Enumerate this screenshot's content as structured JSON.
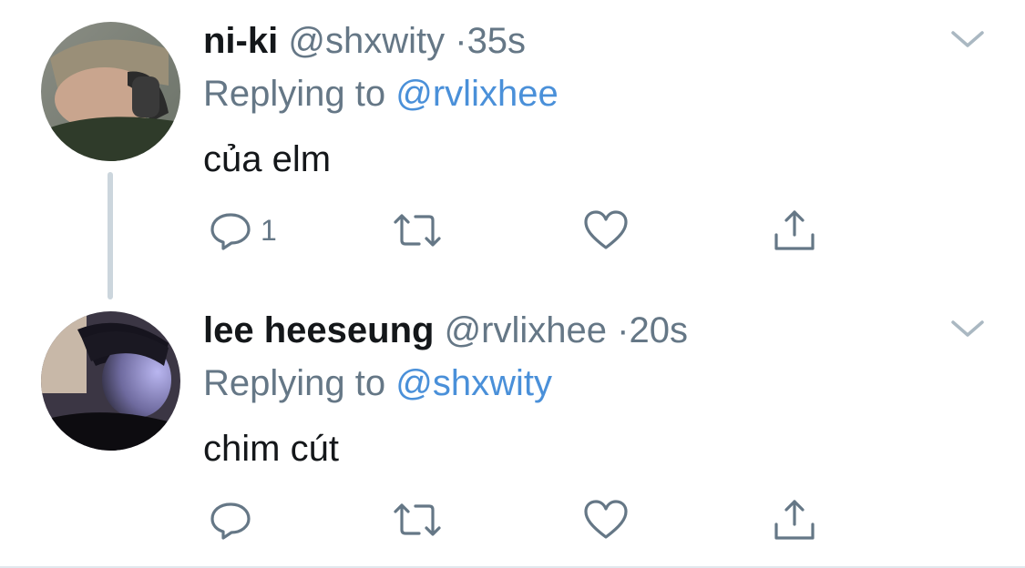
{
  "tweets": [
    {
      "name": "ni-ki",
      "handle": "@shxwity",
      "separator": "·",
      "time": "35s",
      "replying_prefix": "Replying to",
      "replying_handle": "@rvlixhee",
      "text": "của elm",
      "reply_count": "1"
    },
    {
      "name": "lee heeseung",
      "handle": "@rvlixhee",
      "separator": "·",
      "time": "20s",
      "replying_prefix": "Replying to",
      "replying_handle": "@shxwity",
      "text": "chim cút",
      "reply_count": ""
    }
  ],
  "colors": {
    "link": "#4a90d9",
    "muted": "#657786",
    "text": "#14171a",
    "thread_line": "#ccd6dd"
  },
  "icons": [
    "reply-icon",
    "retweet-icon",
    "like-icon",
    "share-icon",
    "caret-down-icon"
  ]
}
